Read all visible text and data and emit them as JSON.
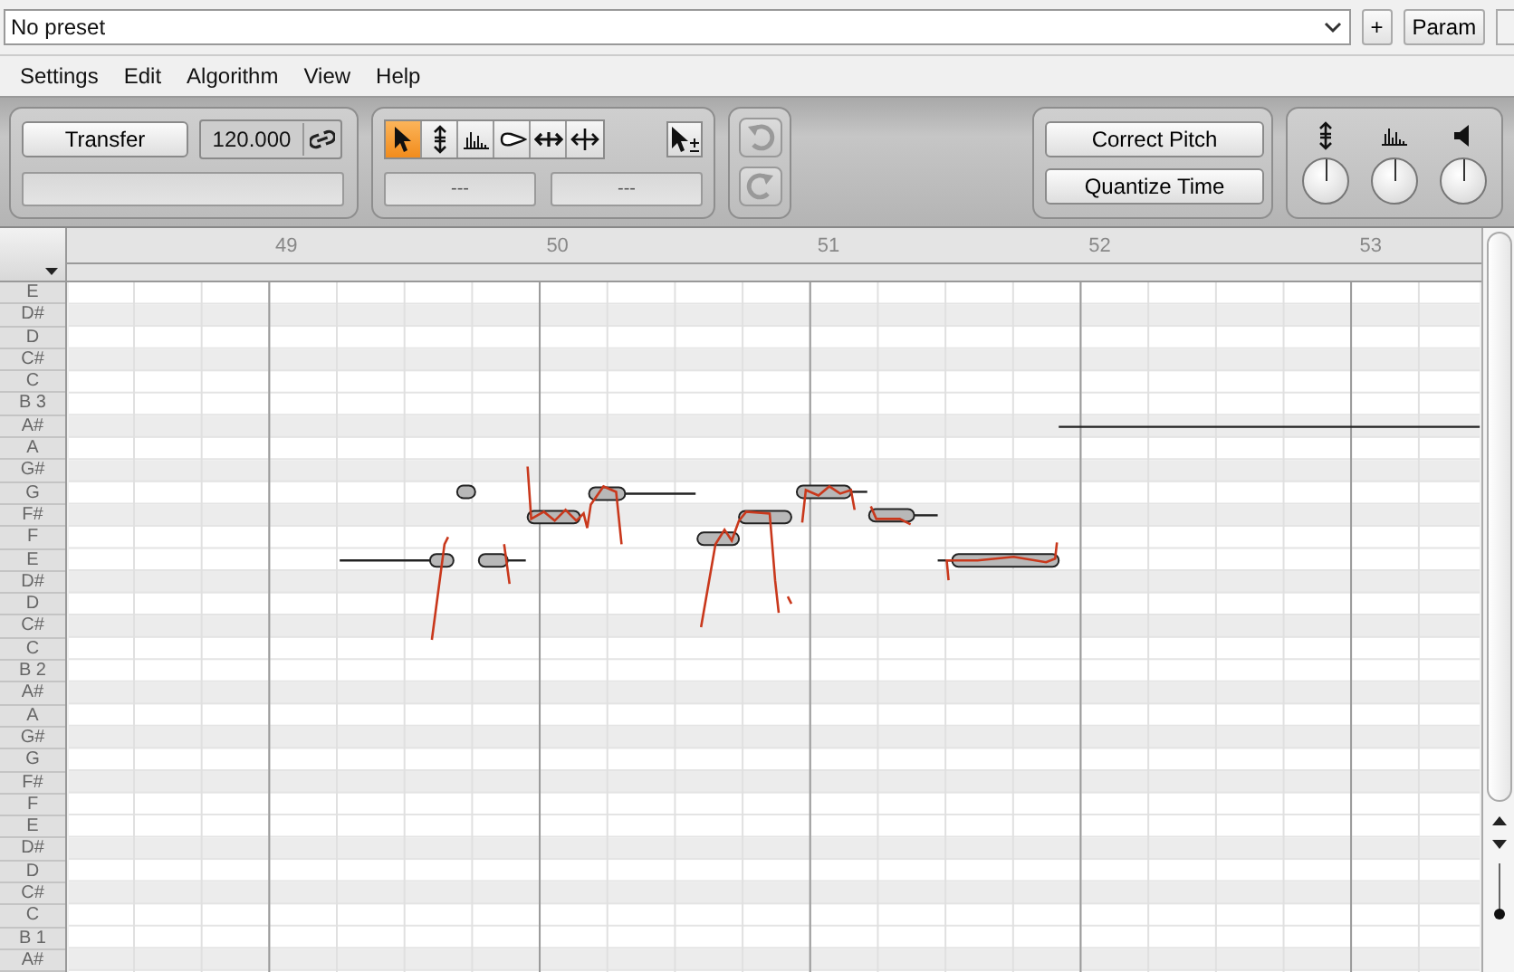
{
  "preset_bar": {
    "preset": "No preset",
    "add_button": "+",
    "param_button": "Param"
  },
  "menu": [
    "Settings",
    "Edit",
    "Algorithm",
    "View",
    "Help"
  ],
  "toolbar": {
    "transfer_button": "Transfer",
    "tempo": "120.000",
    "tools": [
      {
        "kind": "pointer",
        "selected": true
      },
      {
        "kind": "pitch",
        "selected": false
      },
      {
        "kind": "amplitude",
        "selected": false
      },
      {
        "kind": "formant",
        "selected": false
      },
      {
        "kind": "time",
        "selected": false
      },
      {
        "kind": "separation",
        "selected": false
      }
    ],
    "fields": [
      "---",
      "---"
    ],
    "undo": {
      "disabled": true
    },
    "redo": {
      "disabled": true
    },
    "correct_pitch_button": "Correct Pitch",
    "quantize_time_button": "Quantize Time",
    "knobs": [
      {
        "kind": "pitch"
      },
      {
        "kind": "amplitude"
      },
      {
        "kind": "volume"
      }
    ]
  },
  "ruler": {
    "bars": [
      "49",
      "50",
      "51",
      "52",
      "53"
    ]
  },
  "keys": [
    {
      "label": "E",
      "kind": "natural"
    },
    {
      "label": "D#",
      "kind": "sharp"
    },
    {
      "label": "D",
      "kind": "natural"
    },
    {
      "label": "C#",
      "kind": "sharp"
    },
    {
      "label": "C",
      "kind": "natural"
    },
    {
      "label": "B 3",
      "kind": "natural"
    },
    {
      "label": "A#",
      "kind": "sharp"
    },
    {
      "label": "A",
      "kind": "natural"
    },
    {
      "label": "G#",
      "kind": "sharp"
    },
    {
      "label": "G",
      "kind": "natural"
    },
    {
      "label": "F#",
      "kind": "sharp"
    },
    {
      "label": "F",
      "kind": "natural"
    },
    {
      "label": "E",
      "kind": "natural"
    },
    {
      "label": "D#",
      "kind": "sharp"
    },
    {
      "label": "D",
      "kind": "natural"
    },
    {
      "label": "C#",
      "kind": "sharp"
    },
    {
      "label": "C",
      "kind": "natural"
    },
    {
      "label": "B 2",
      "kind": "natural"
    },
    {
      "label": "A#",
      "kind": "sharp"
    },
    {
      "label": "A",
      "kind": "natural"
    },
    {
      "label": "G#",
      "kind": "sharp"
    },
    {
      "label": "G",
      "kind": "natural"
    },
    {
      "label": "F#",
      "kind": "sharp"
    },
    {
      "label": "F",
      "kind": "natural"
    },
    {
      "label": "E",
      "kind": "natural"
    },
    {
      "label": "D#",
      "kind": "sharp"
    },
    {
      "label": "D",
      "kind": "natural"
    },
    {
      "label": "C#",
      "kind": "sharp"
    },
    {
      "label": "C",
      "kind": "natural"
    },
    {
      "label": "B 1",
      "kind": "natural"
    },
    {
      "label": "A#",
      "kind": "sharp"
    }
  ]
}
